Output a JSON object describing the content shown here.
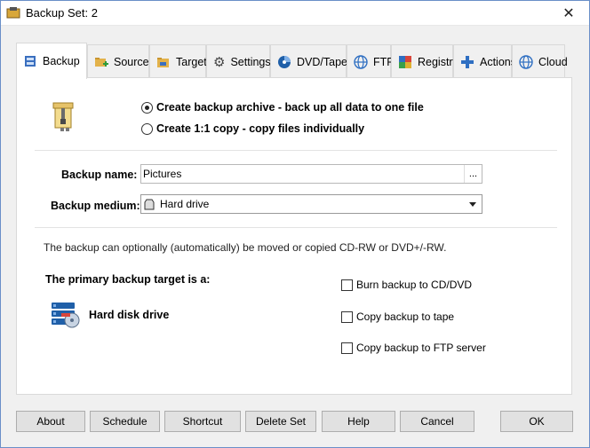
{
  "window": {
    "title": "Backup Set: 2"
  },
  "tabs": [
    {
      "label": "Backup",
      "icon": "archive-icon"
    },
    {
      "label": "Source",
      "icon": "source-folder-icon"
    },
    {
      "label": "Target",
      "icon": "target-folder-icon"
    },
    {
      "label": "Settings",
      "icon": "gear-icon"
    },
    {
      "label": "DVD/Tape",
      "icon": "disc-icon"
    },
    {
      "label": "FTP",
      "icon": "globe-icon"
    },
    {
      "label": "Registry",
      "icon": "registry-icon"
    },
    {
      "label": "Actions",
      "icon": "plus-icon"
    },
    {
      "label": "Cloud",
      "icon": "globe-icon"
    }
  ],
  "mode": {
    "option_archive": "Create backup archive - back up all data to one file",
    "option_copy": "Create 1:1 copy - copy files individually",
    "selected": "archive"
  },
  "form": {
    "name_label": "Backup name:",
    "name_value": "Pictures",
    "browse_label": "...",
    "medium_label": "Backup medium:",
    "medium_value": "Hard drive"
  },
  "info_text": "The backup can optionally (automatically) be moved or copied CD-RW or DVD+/-RW.",
  "target": {
    "heading": "The primary backup target is a:",
    "device": "Hard disk drive"
  },
  "options": [
    {
      "label": "Burn backup to CD/DVD",
      "checked": false
    },
    {
      "label": "Copy backup to tape",
      "checked": false
    },
    {
      "label": "Copy backup to FTP server",
      "checked": false
    }
  ],
  "buttons": {
    "about": "About",
    "schedule": "Schedule",
    "shortcut": "Shortcut",
    "delete_set": "Delete Set",
    "help": "Help",
    "cancel": "Cancel",
    "ok": "OK"
  },
  "colors": {
    "accent": "#2f6fc2",
    "disk_blue": "#1f5fa8"
  }
}
